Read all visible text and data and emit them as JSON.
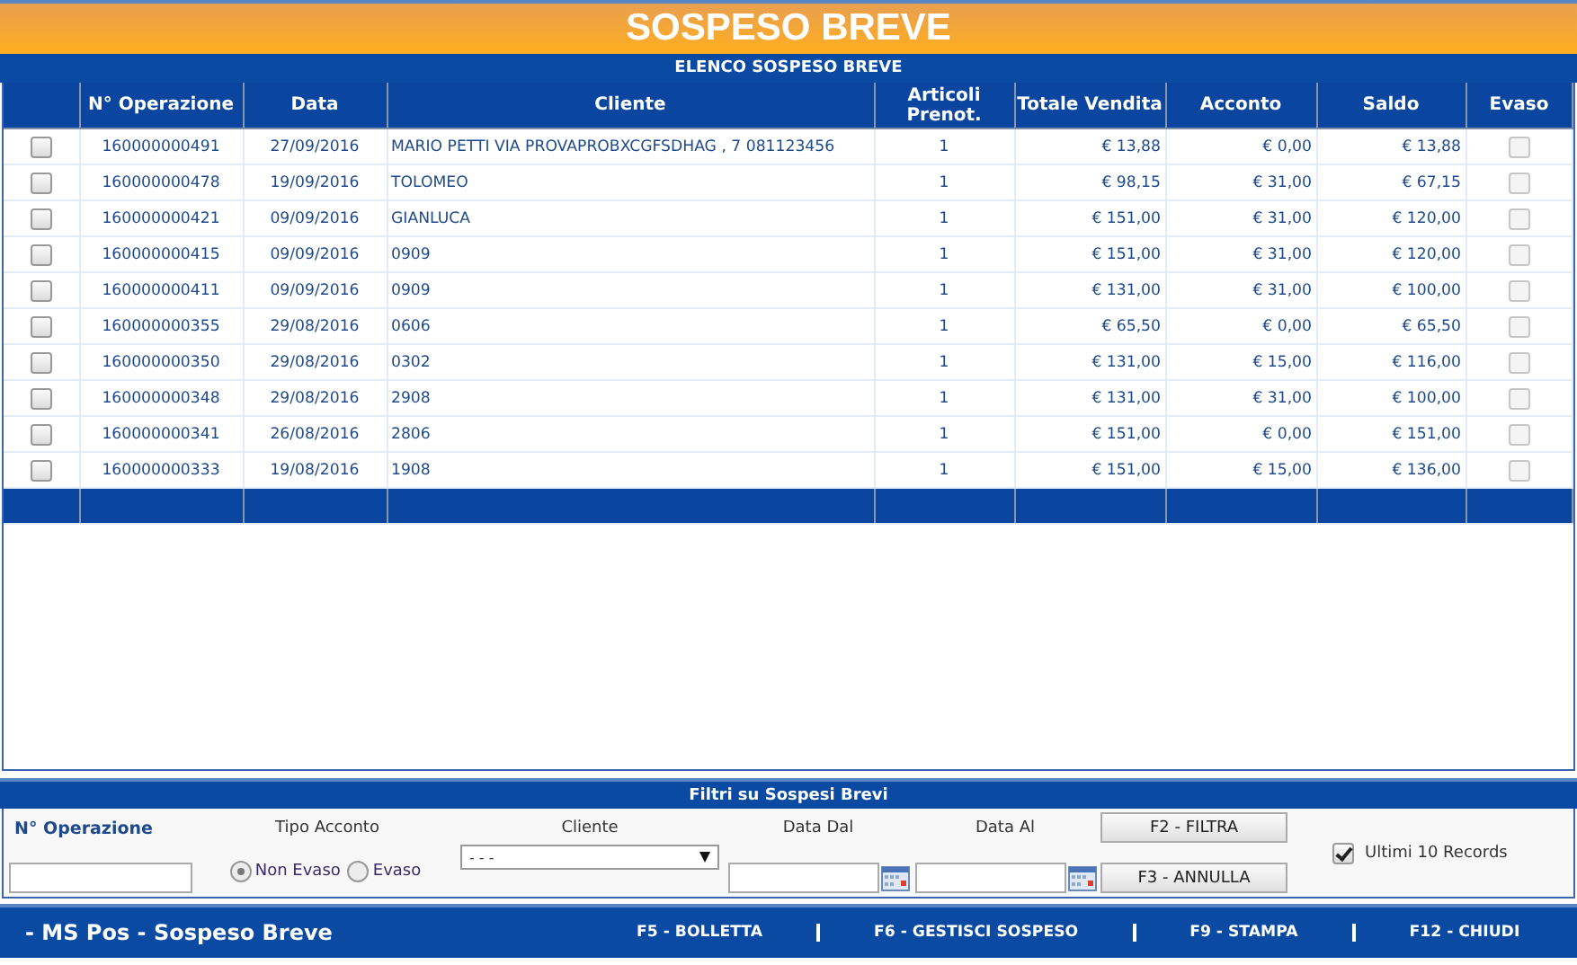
{
  "header": {
    "title": "SOSPESO BREVE",
    "subtitle": "ELENCO SOSPESO BREVE"
  },
  "table": {
    "columns": [
      "N° Operazione",
      "Data",
      "Cliente",
      "Articoli Prenot.",
      "Totale Vendita",
      "Acconto",
      "Saldo",
      "Evaso"
    ],
    "rows": [
      {
        "selected": false,
        "operazione": "160000000491",
        "data": "27/09/2016",
        "cliente": "MARIO PETTI VIA PROVAPROBXCGFSDHAG , 7 081123456",
        "articoli": "1",
        "totale": "€ 13,88",
        "acconto": "€ 0,00",
        "saldo": "€ 13,88",
        "evaso": false
      },
      {
        "selected": false,
        "operazione": "160000000478",
        "data": "19/09/2016",
        "cliente": "TOLOMEO",
        "articoli": "1",
        "totale": "€ 98,15",
        "acconto": "€ 31,00",
        "saldo": "€ 67,15",
        "evaso": false
      },
      {
        "selected": false,
        "operazione": "160000000421",
        "data": "09/09/2016",
        "cliente": "GIANLUCA",
        "articoli": "1",
        "totale": "€ 151,00",
        "acconto": "€ 31,00",
        "saldo": "€ 120,00",
        "evaso": false
      },
      {
        "selected": false,
        "operazione": "160000000415",
        "data": "09/09/2016",
        "cliente": "0909",
        "articoli": "1",
        "totale": "€ 151,00",
        "acconto": "€ 31,00",
        "saldo": "€ 120,00",
        "evaso": false
      },
      {
        "selected": false,
        "operazione": "160000000411",
        "data": "09/09/2016",
        "cliente": "0909",
        "articoli": "1",
        "totale": "€ 131,00",
        "acconto": "€ 31,00",
        "saldo": "€ 100,00",
        "evaso": false
      },
      {
        "selected": false,
        "operazione": "160000000355",
        "data": "29/08/2016",
        "cliente": "0606",
        "articoli": "1",
        "totale": "€ 65,50",
        "acconto": "€ 0,00",
        "saldo": "€ 65,50",
        "evaso": false
      },
      {
        "selected": false,
        "operazione": "160000000350",
        "data": "29/08/2016",
        "cliente": "0302",
        "articoli": "1",
        "totale": "€ 131,00",
        "acconto": "€ 15,00",
        "saldo": "€ 116,00",
        "evaso": false
      },
      {
        "selected": false,
        "operazione": "160000000348",
        "data": "29/08/2016",
        "cliente": "2908",
        "articoli": "1",
        "totale": "€ 131,00",
        "acconto": "€ 31,00",
        "saldo": "€ 100,00",
        "evaso": false
      },
      {
        "selected": false,
        "operazione": "160000000341",
        "data": "26/08/2016",
        "cliente": "2806",
        "articoli": "1",
        "totale": "€ 151,00",
        "acconto": "€ 0,00",
        "saldo": "€ 151,00",
        "evaso": false
      },
      {
        "selected": false,
        "operazione": "160000000333",
        "data": "19/08/2016",
        "cliente": "1908",
        "articoli": "1",
        "totale": "€ 151,00",
        "acconto": "€ 15,00",
        "saldo": "€ 136,00",
        "evaso": false
      }
    ]
  },
  "filters": {
    "title": "Filtri su Sospesi Brevi",
    "operazione_label": "N° Operazione",
    "tipo_label": "Tipo Acconto",
    "radios": [
      {
        "label": "Non Evaso",
        "selected": true
      },
      {
        "label": "Evaso",
        "selected": false
      }
    ],
    "cliente_label": "Cliente",
    "cliente_value": "- - -",
    "data_dal_label": "Data Dal",
    "data_al_label": "Data Al",
    "buttons": [
      "F2 - FILTRA",
      "F3 - ANNULLA"
    ],
    "last_records": {
      "label": "Ultimi 10 Records",
      "checked": true
    }
  },
  "status_bar": {
    "title": "- MS Pos - Sospeso Breve",
    "actions": [
      "F5 - BOLLETTA",
      "F6 - GESTISCI SOSPESO",
      "F9 - STAMPA",
      "F12 - CHIUDI"
    ]
  }
}
